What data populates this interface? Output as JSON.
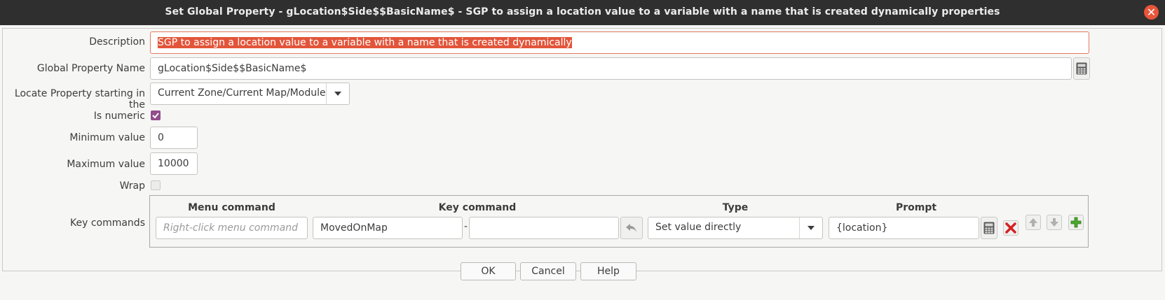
{
  "window": {
    "title": "Set Global Property - gLocation$Side$$BasicName$ - SGP to assign a location value to a variable with a name that is created dynamically properties"
  },
  "form": {
    "description_label": "Description",
    "description_value": "SGP to assign a location value to a variable with a name that is created dynamically",
    "global_property_name_label": "Global Property Name",
    "global_property_name_value": "gLocation$Side$$BasicName$",
    "locate_label": "Locate Property starting in the",
    "locate_value": "Current Zone/Current Map/Module",
    "is_numeric_label": "Is numeric",
    "is_numeric_checked": true,
    "minimum_label": "Minimum value",
    "minimum_value": "0",
    "maximum_label": "Maximum value",
    "maximum_value": "10000",
    "wrap_label": "Wrap",
    "wrap_checked": false,
    "key_commands_label": "Key commands"
  },
  "key_commands": {
    "headers": {
      "menu_command": "Menu command",
      "key_command": "Key command",
      "type": "Type",
      "prompt": "Prompt"
    },
    "row": {
      "menu_command_placeholder": "Right-click menu command",
      "key_command_value": "MovedOnMap",
      "separator": "-",
      "key_command_2_value": "",
      "type_value": "Set value directly",
      "prompt_value": "{location}"
    }
  },
  "buttons": {
    "ok": "OK",
    "cancel": "Cancel",
    "help": "Help"
  },
  "colors": {
    "titlebar": "#2f2f2f",
    "close": "#e8553a",
    "selection": "#e2553a",
    "checkbox_on": "#924d8b"
  }
}
